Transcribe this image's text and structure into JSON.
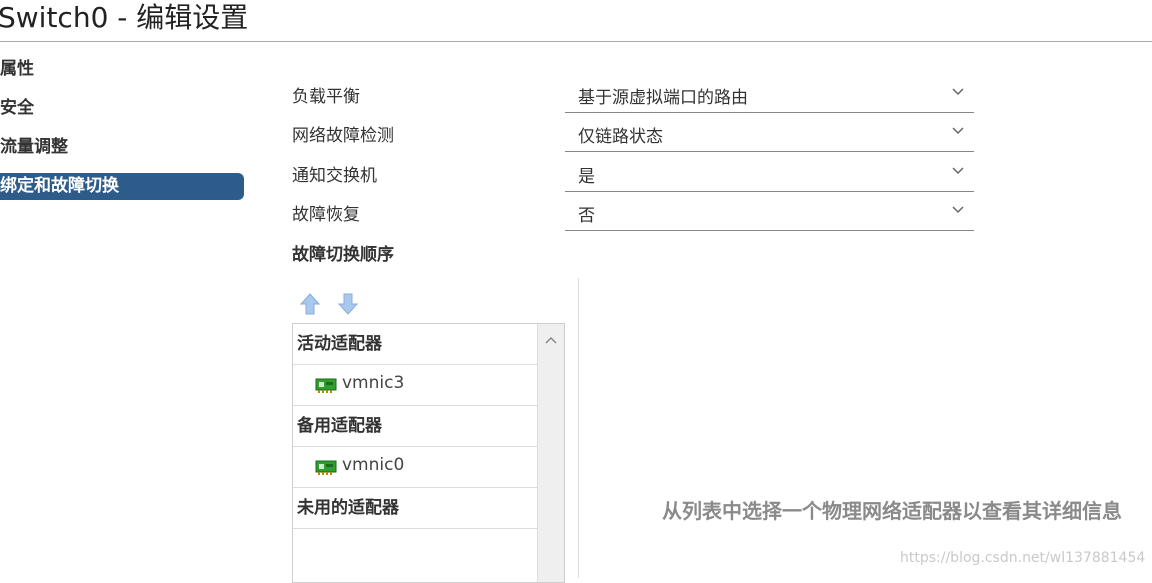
{
  "dialog": {
    "title": "Switch0 - 编辑设置"
  },
  "nav": {
    "items": [
      {
        "label": "属性",
        "active": false
      },
      {
        "label": "安全",
        "active": false
      },
      {
        "label": "流量调整",
        "active": false
      },
      {
        "label": "绑定和故障切换",
        "active": true
      }
    ]
  },
  "form": {
    "load_balancing": {
      "label": "负载平衡",
      "value": "基于源虚拟端口的路由"
    },
    "failure_detection": {
      "label": "网络故障检测",
      "value": "仅链路状态"
    },
    "notify_switches": {
      "label": "通知交换机",
      "value": "是"
    },
    "failback": {
      "label": "故障恢复",
      "value": "否"
    }
  },
  "failover_order": {
    "title": "故障切换顺序",
    "move_up_icon": "arrow-up-icon",
    "move_down_icon": "arrow-down-icon",
    "groups": {
      "active": {
        "label": "活动适配器",
        "adapters": [
          "vmnic3"
        ]
      },
      "standby": {
        "label": "备用适配器",
        "adapters": [
          "vmnic0"
        ]
      },
      "unused": {
        "label": "未用的适配器",
        "adapters": []
      }
    }
  },
  "details": {
    "empty_message": "从列表中选择一个物理网络适配器以查看其详细信息"
  },
  "watermark": "https://blog.csdn.net/wl137881454",
  "colors": {
    "active_nav": "#2e5c8a",
    "nic_green": "#2f9e2f",
    "arrow_blue": "#a9c8ee"
  }
}
